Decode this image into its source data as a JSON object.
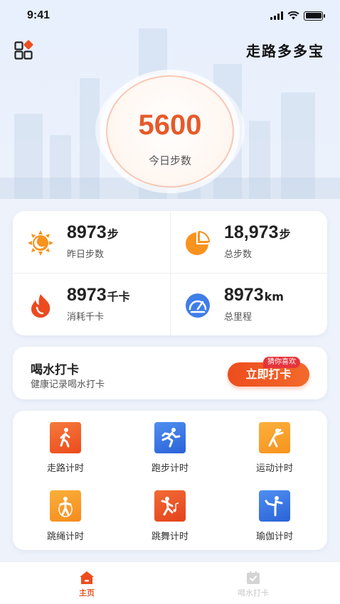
{
  "status_bar": {
    "time": "9:41"
  },
  "header": {
    "title": "走路多多宝",
    "menu_icon": "grid-menu-icon"
  },
  "today": {
    "steps": "5600",
    "label": "今日步数"
  },
  "stats": [
    {
      "value": "8973",
      "unit": "步",
      "label": "昨日步数",
      "icon": "sun-moon-icon"
    },
    {
      "value": "18,973",
      "unit": "步",
      "label": "总步数",
      "icon": "pie-chart-icon"
    },
    {
      "value": "8973",
      "unit": "千卡",
      "label": "消耗千卡",
      "icon": "flame-icon"
    },
    {
      "value": "8973",
      "unit": "km",
      "label": "总里程",
      "icon": "speedometer-icon"
    }
  ],
  "water": {
    "title": "喝水打卡",
    "subtitle": "健康记录喝水打卡",
    "button_label": "立即打卡",
    "tag": "猜你喜欢"
  },
  "activities": [
    {
      "label": "走路计时",
      "icon": "walking-icon",
      "color": "#f0521f"
    },
    {
      "label": "跑步计时",
      "icon": "running-icon",
      "color": "#2f6fe0"
    },
    {
      "label": "运动计时",
      "icon": "stretching-icon",
      "color": "#f7931e"
    },
    {
      "label": "跳绳计时",
      "icon": "jump-rope-icon",
      "color": "#f7941d"
    },
    {
      "label": "跳舞计时",
      "icon": "dancing-icon",
      "color": "#e8481f"
    },
    {
      "label": "瑜伽计时",
      "icon": "yoga-icon",
      "color": "#2f6fe0"
    }
  ],
  "tabbar": [
    {
      "label": "主页",
      "icon": "home-icon",
      "active": true
    },
    {
      "label": "喝水打卡",
      "icon": "checkin-icon",
      "active": false
    }
  ],
  "colors": {
    "accent": "#e65a2a",
    "blue": "#2f6fe0",
    "orange": "#f7931e"
  }
}
